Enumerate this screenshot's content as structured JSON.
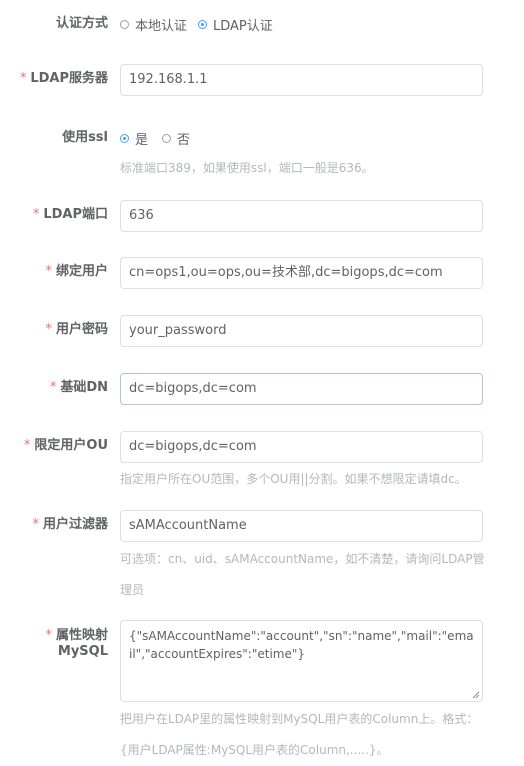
{
  "auth": {
    "label": "认证方式",
    "options": [
      {
        "label": "本地认证",
        "checked": false
      },
      {
        "label": "LDAP认证",
        "checked": true
      }
    ]
  },
  "server": {
    "label": "LDAP服务器",
    "value": "192.168.1.1"
  },
  "ssl": {
    "label": "使用ssl",
    "options": [
      {
        "label": "是",
        "checked": true
      },
      {
        "label": "否",
        "checked": false
      }
    ],
    "hint": "标准端口389，如果使用ssl，端口一般是636。"
  },
  "port": {
    "label": "LDAP端口",
    "value": "636"
  },
  "bind_user": {
    "label": "绑定用户",
    "value": "cn=ops1,ou=ops,ou=技术部,dc=bigops,dc=com"
  },
  "password": {
    "label": "用户密码",
    "value": "your_password"
  },
  "base_dn": {
    "label": "基础DN",
    "value": "dc=bigops,dc=com"
  },
  "user_ou": {
    "label": "限定用户OU",
    "value": "dc=bigops,dc=com",
    "hint": "指定用户所在OU范围，多个OU用||分割。如果不想限定请填dc。"
  },
  "user_filter": {
    "label": "用户过滤器",
    "value": "sAMAccountName",
    "hint_line1": "可选项：cn、uid、sAMAccountName，如不清楚，请询问LDAP管",
    "hint_line2": "理员"
  },
  "attr_map": {
    "label_line1": "属性映射",
    "label_line2": "MySQL",
    "value": "{\"sAMAccountName\":\"account\",\"sn\":\"name\",\"mail\":\"email\",\"accountExpires\":\"etime\"}",
    "hint_line1": "把用户在LDAP里的属性映射到MySQL用户表的Column上。格式：",
    "hint_line2": "{用户LDAP属性:MySQL用户表的Column,.....}。"
  },
  "required_mark": "*",
  "colors": {
    "required": "#f56c6c",
    "accent": "#409eff",
    "hint": "#b4b7bd"
  }
}
